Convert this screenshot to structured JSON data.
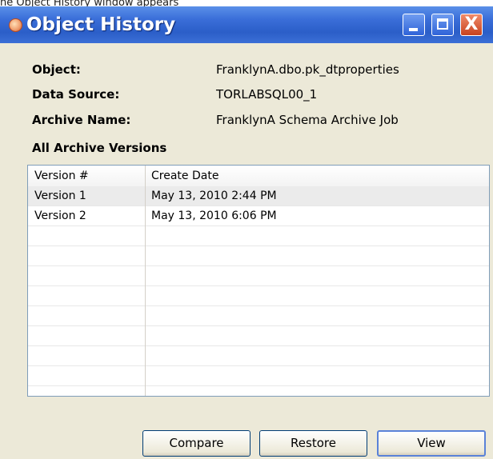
{
  "caption": "he Object History window appears",
  "window": {
    "title": "Object History"
  },
  "titlebar_buttons": {
    "close_glyph": "X"
  },
  "details": {
    "object_label": "Object:",
    "object_value": "FranklynA.dbo.pk_dtproperties",
    "data_source_label": "Data Source:",
    "data_source_value": "TORLABSQL00_1",
    "archive_name_label": "Archive Name:",
    "archive_name_value": "FranklynA Schema Archive Job"
  },
  "versions": {
    "section_title": "All Archive Versions",
    "columns": [
      "Version #",
      "Create Date"
    ],
    "rows": [
      {
        "version": "Version 1",
        "create_date": "May 13, 2010 2:44 PM",
        "selected": true
      },
      {
        "version": "Version 2",
        "create_date": "May 13, 2010 6:06 PM",
        "selected": false
      }
    ],
    "empty_row_count": 9
  },
  "buttons": {
    "compare": "Compare",
    "restore": "Restore",
    "view": "View"
  }
}
